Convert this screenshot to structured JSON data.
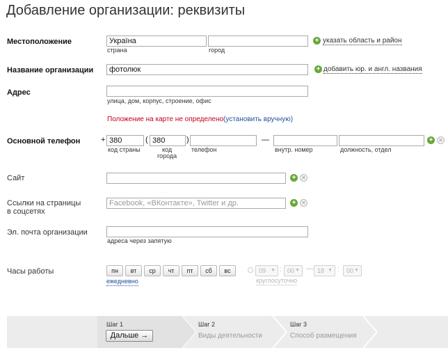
{
  "page": {
    "title": "Добавление организации: реквизиты"
  },
  "location": {
    "label": "Местоположение",
    "country_value": "Україна",
    "country_sub": "страна",
    "city_value": "",
    "city_sub": "город",
    "add_link": "указать область и район"
  },
  "org_name": {
    "label": "Название организации",
    "value": "фотолюк",
    "add_link": "добавить юр. и англ. названия"
  },
  "address": {
    "label": "Адрес",
    "value": "",
    "sub": "улица, дом, корпус, строение, офис",
    "map_status": "Положение на карте не определено",
    "map_link": "(установить вручную)"
  },
  "phone": {
    "label": "Основной телефон",
    "plus": "+",
    "country_code": "380",
    "country_code_sub": "код страны",
    "open_paren": "(",
    "city_code": "380",
    "city_code_sub_1": "код",
    "city_code_sub_2": "города",
    "close_paren": ")",
    "number": "",
    "number_sub": "телефон",
    "dash": "—",
    "ext": "",
    "ext_sub": "внутр. номер",
    "position": "",
    "position_sub": "должность, отдел"
  },
  "site": {
    "label": "Сайт",
    "value": ""
  },
  "social": {
    "label_1": "Ссылки на страницы",
    "label_2": "в соцсетях",
    "placeholder": "Facebook, «ВКонтакте», Twitter и др."
  },
  "email": {
    "label": "Эл. почта организации",
    "value": "",
    "sub": "адреса через запятую"
  },
  "hours": {
    "label": "Часы работы",
    "days": [
      "пн",
      "вт",
      "ср",
      "чт",
      "пт",
      "сб",
      "вс"
    ],
    "daily_link": "ежедневно",
    "from_hour": "09",
    "from_min": "00",
    "dash": "—",
    "to_hour": "18",
    "to_min": "00",
    "round_clock_link": "круглосуточно"
  },
  "steps": [
    {
      "num": "Шаг 1",
      "button": "Дальше →"
    },
    {
      "num": "Шаг 2",
      "name": "Виды деятельности"
    },
    {
      "num": "Шаг 3",
      "name": "Способ размещения"
    }
  ],
  "colors": {
    "accent_green": "#66a838",
    "warning_red": "#c0001a",
    "link_blue": "#1f4e9e",
    "footer_bg": "#ececec"
  },
  "icons": {
    "add": "plus-circle-icon",
    "remove": "close-circle-icon",
    "select_arrow": "chevron-down-icon"
  }
}
